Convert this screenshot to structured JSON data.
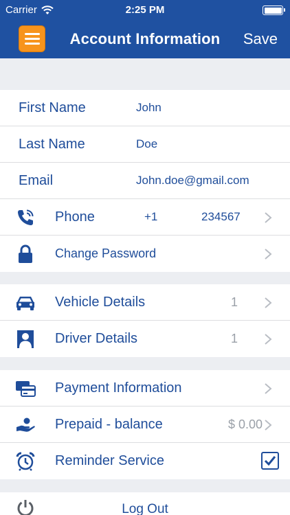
{
  "status_bar": {
    "carrier": "Carrier",
    "time": "2:25 PM"
  },
  "nav": {
    "title": "Account Information",
    "save_label": "Save"
  },
  "profile": {
    "first_name_label": "First Name",
    "first_name_value": "John",
    "last_name_label": "Last Name",
    "last_name_value": "Doe",
    "email_label": "Email",
    "email_value": "John.doe@gmail.com",
    "phone_label": "Phone",
    "phone_code": "+1",
    "phone_number": "234567",
    "change_password_label": "Change Password"
  },
  "vehicles": {
    "vehicle_label": "Vehicle Details",
    "vehicle_count": "1",
    "driver_label": "Driver Details",
    "driver_count": "1"
  },
  "payments": {
    "payment_label": "Payment Information",
    "prepaid_label": "Prepaid - balance",
    "prepaid_value": "$ 0.00",
    "reminder_label": "Reminder Service",
    "reminder_checked": true
  },
  "logout": {
    "label": "Log Out"
  },
  "colors": {
    "nav_blue": "#1f51a1",
    "text_blue": "#1f4d9a",
    "menu_orange": "#f7941d",
    "muted_gray": "#9aa0a8",
    "background": "#eceef2"
  },
  "icons": [
    "wifi-icon",
    "battery-icon",
    "menu-icon",
    "phone-icon",
    "lock-icon",
    "car-icon",
    "driver-icon",
    "payment-card-icon",
    "hand-coin-icon",
    "alarm-clock-icon",
    "checkmark-icon",
    "power-icon",
    "chevron-right-icon"
  ]
}
